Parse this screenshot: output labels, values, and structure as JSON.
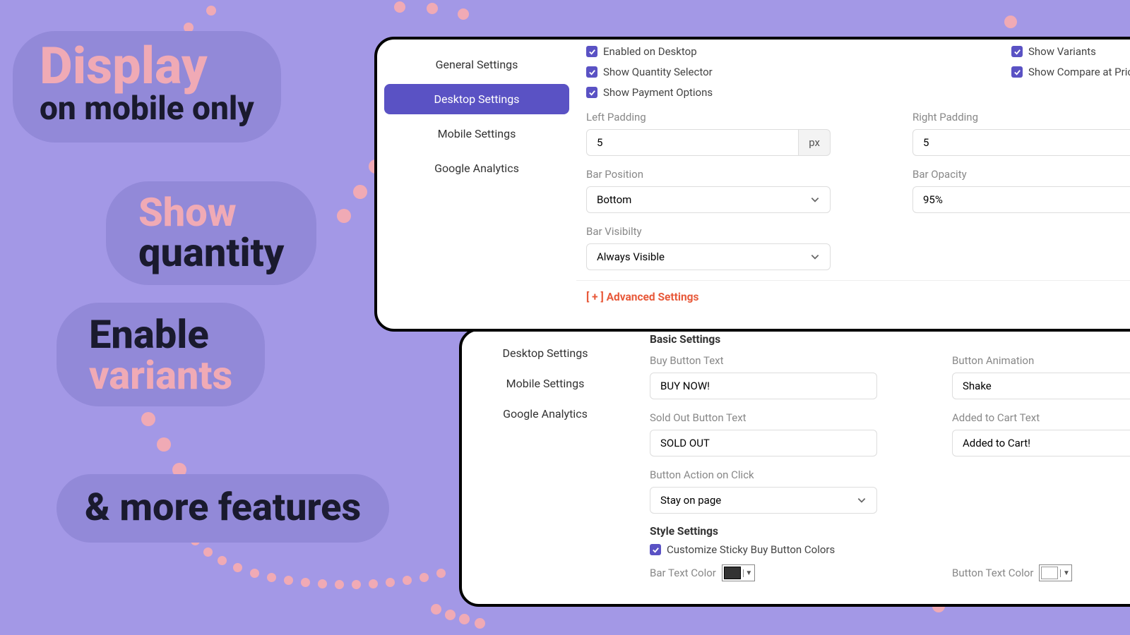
{
  "pills": {
    "p1_l1": "Display",
    "p1_l2": "on mobile only",
    "p2_l1": "Show",
    "p2_l2": "quantity",
    "p3_l1": "Enable",
    "p3_l2": "variants",
    "p4": "& more features"
  },
  "win1": {
    "nav": {
      "general": "General Settings",
      "desktop": "Desktop Settings",
      "mobile": "Mobile Settings",
      "ga": "Google Analytics"
    },
    "checks": {
      "enabled": "Enabled on Desktop",
      "variants": "Show Variants",
      "qty": "Show Quantity Selector",
      "compare": "Show Compare at Price",
      "payment": "Show Payment Options"
    },
    "left_padding_label": "Left Padding",
    "left_padding_value": "5",
    "px_unit": "px",
    "right_padding_label": "Right Padding",
    "right_padding_value": "5",
    "bar_position_label": "Bar Position",
    "bar_position_value": "Bottom",
    "bar_opacity_label": "Bar Opacity",
    "bar_opacity_value": "95%",
    "bar_visibility_label": "Bar Visibilty",
    "bar_visibility_value": "Always Visible",
    "advanced": "[ + ] Advanced Settings"
  },
  "win2": {
    "nav": {
      "desktop": "Desktop Settings",
      "mobile": "Mobile Settings",
      "ga": "Google Analytics"
    },
    "basic_title": "Basic Settings",
    "buy_btn_label": "Buy Button Text",
    "buy_btn_value": "BUY NOW!",
    "btn_anim_label": "Button Animation",
    "btn_anim_value": "Shake",
    "sold_label": "Sold Out Button Text",
    "sold_value": "SOLD OUT",
    "added_label": "Added to Cart Text",
    "added_value": "Added to Cart!",
    "action_label": "Button Action on Click",
    "action_value": "Stay on page",
    "style_title": "Style Settings",
    "customize_label": "Customize Sticky Buy Button Colors",
    "bar_text_color_label": "Bar Text Color",
    "btn_text_color_label": "Button Text Color"
  }
}
